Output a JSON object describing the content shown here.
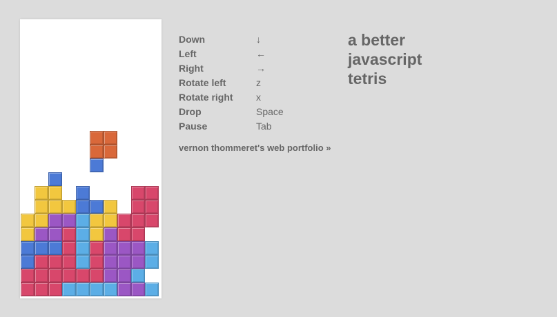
{
  "game": {
    "title_lines": [
      "a better",
      "javascript",
      "tetris"
    ],
    "cell_colors": {
      "Y": "#f2c73f",
      "P": "#9b57c4",
      "R": "#d8476b",
      "B": "#4c7ad6",
      "L": "#5caee6",
      "O": "#d9683a"
    },
    "active_piece": {
      "type": "O",
      "color": "#d9683a",
      "rows": [
        8,
        9
      ],
      "cols": [
        5,
        6
      ]
    },
    "stack": [
      ".....B....",
      "..B....",
      ".YY.B...RR",
      ".YYYBBY.RR",
      "YYPPLYYRRR",
      "YPPRLYPRR",
      "BBBRLRPPPL",
      "BRRRLRPPPL",
      "RRRRRRPPL",
      "RRRLLLLPPL"
    ]
  },
  "controls": [
    {
      "action": "Down",
      "key": "↓"
    },
    {
      "action": "Left",
      "key": "←"
    },
    {
      "action": "Right",
      "key": "→"
    },
    {
      "action": "Rotate left",
      "key": "z"
    },
    {
      "action": "Rotate right",
      "key": "x"
    },
    {
      "action": "Drop",
      "key": "Space"
    },
    {
      "action": "Pause",
      "key": "Tab"
    }
  ],
  "portfolio_link": "vernon thommeret's web portfolio »"
}
